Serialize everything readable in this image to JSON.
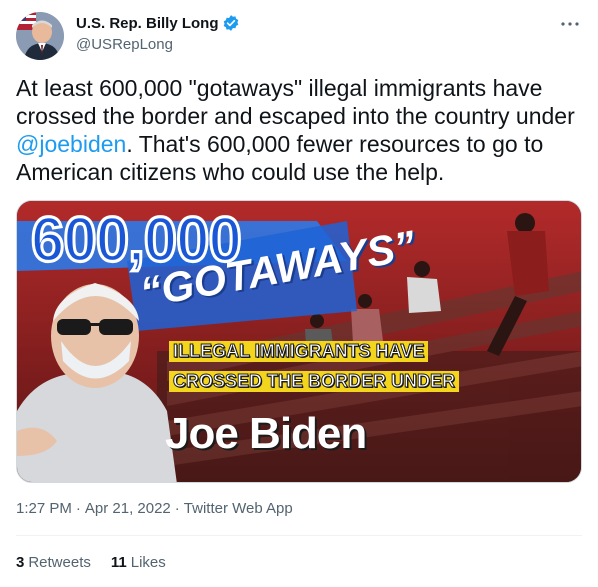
{
  "author": {
    "display_name": "U.S. Rep. Billy Long",
    "handle": "@USRepLong",
    "verified": true
  },
  "tweet": {
    "text_before": "At least 600,000 \"gotaways\" illegal immigrants have crossed the border and escaped into the country under ",
    "mention": "@joebiden",
    "text_after": ". That's 600,000 fewer resources to go to American citizens who could use the help."
  },
  "media": {
    "headline_number": "600,000",
    "headline_word": "“GOTAWAYS”",
    "line1": "ILLEGAL IMMIGRANTS HAVE",
    "line2": "CROSSED THE BORDER UNDER",
    "name": "Joe Biden"
  },
  "meta": {
    "time": "1:27 PM",
    "separator1": "·",
    "date": "Apr 21, 2022",
    "separator2": "·",
    "source": "Twitter Web App"
  },
  "stats": {
    "retweets_count": "3",
    "retweets_label": "Retweets",
    "likes_count": "11",
    "likes_label": "Likes"
  },
  "icons": {
    "more": "more-options-icon",
    "verified": "verified-badge-icon"
  },
  "colors": {
    "accent": "#1d9bf0",
    "text": "#0f1419",
    "muted": "#536471"
  }
}
